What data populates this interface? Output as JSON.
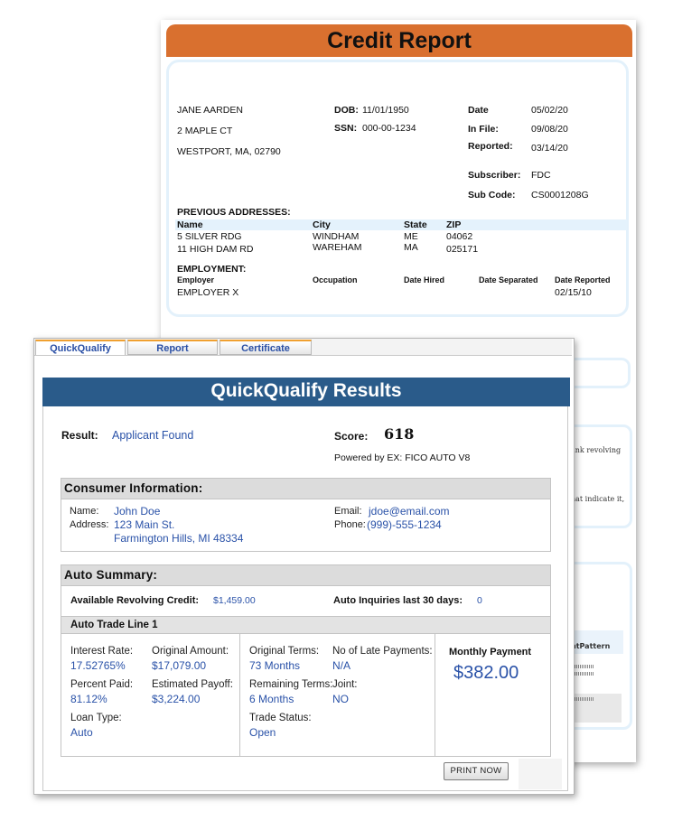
{
  "credit_report": {
    "title": "Credit Report",
    "name": "JANE AARDEN",
    "street": "2 MAPLE CT",
    "city": "WESTPORT, MA, 02790",
    "dob_label": "DOB:",
    "dob": "11/01/1950",
    "ssn_label": "SSN:",
    "ssn": "000-00-1234",
    "date_label": "Date",
    "date": "05/02/20",
    "infile_label": "In File:",
    "infile": "09/08/20",
    "reported_label": "Reported:",
    "reported": "03/14/20",
    "subscriber_label": "Subscriber:",
    "subscriber": "FDC",
    "subcode_label": "Sub Code:",
    "subcode": "CS0001208G",
    "prev_title": "PREVIOUS ADDRESSES:",
    "prev_headers": [
      "Name",
      "City",
      "State",
      "ZIP"
    ],
    "prev_rows": [
      [
        "5 SILVER RDG",
        "WINDHAM",
        "ME",
        "04062"
      ],
      [
        "11 HIGH DAM RD",
        "WAREHAM",
        "MA",
        "025171"
      ]
    ],
    "emp_title": "EMPLOYMENT:",
    "emp_headers": [
      "Employer",
      "Occupation",
      "Date Hired",
      "Date Separated",
      "Date Reported"
    ],
    "emp_employer": "EMPLOYER X",
    "emp_date_reported": "02/15/10",
    "snippets": [
      "ank revolving",
      "hat indicate it,",
      "ntPattern"
    ]
  },
  "quickqualify": {
    "tabs": [
      "QuickQualify",
      "Report",
      "Certificate"
    ],
    "title": "QuickQualify Results",
    "result_label": "Result:",
    "result_value": "Applicant Found",
    "score_label": "Score:",
    "score_value": "618",
    "powered_by": "Powered by EX: FICO AUTO V8",
    "consumer": {
      "header": "Consumer Information:",
      "name_label": "Name:",
      "name": "John Doe",
      "address_label": "Address:",
      "address_line1": "123 Main St.",
      "address_line2": "Farmington Hills, MI 48334",
      "email_label": "Email:",
      "email": "jdoe@email.com",
      "phone_label": "Phone:",
      "phone": "(999)-555-1234"
    },
    "auto_summary": {
      "header": "Auto Summary:",
      "revolving_label": "Available Revolving Credit:",
      "revolving_value": "$1,459.00",
      "inquiries_label": "Auto Inquiries last 30 days:",
      "inquiries_value": "0",
      "trade_line_header": "Auto Trade Line 1",
      "interest_rate_label": "Interest Rate:",
      "interest_rate": "17.52765%",
      "original_amount_label": "Original Amount:",
      "original_amount": "$17,079.00",
      "percent_paid_label": "Percent Paid:",
      "percent_paid": "81.12%",
      "estimated_payoff_label": "Estimated Payoff:",
      "estimated_payoff": "$3,224.00",
      "loan_type_label": "Loan Type:",
      "loan_type": "Auto",
      "original_terms_label": "Original Terms:",
      "original_terms": "73 Months",
      "late_payments_label": "No of Late Payments:",
      "late_payments": "N/A",
      "remaining_terms_label": "Remaining Terms:",
      "remaining_terms": "6 Months",
      "joint_label": "Joint:",
      "joint": "NO",
      "trade_status_label": "Trade Status:",
      "trade_status": "Open",
      "monthly_payment_label": "Monthly Payment",
      "monthly_payment": "$382.00"
    },
    "print_button": "PRINT NOW"
  }
}
